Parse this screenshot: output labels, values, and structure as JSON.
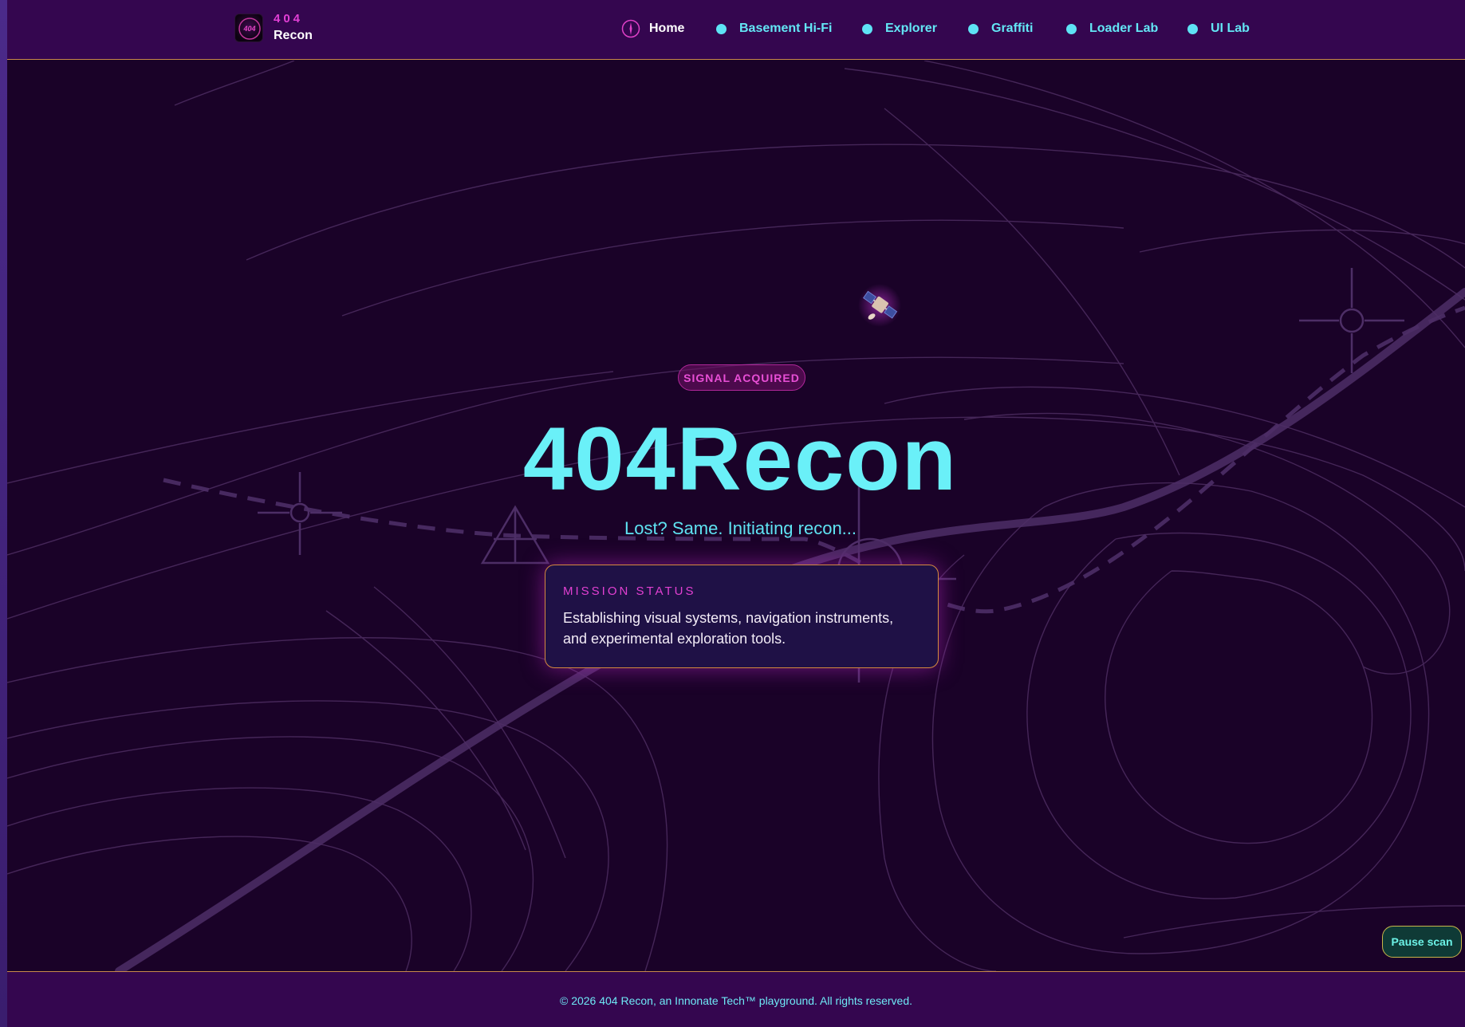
{
  "brand": {
    "logo_text": "404",
    "top": "404",
    "bottom": "Recon"
  },
  "nav": {
    "items": [
      {
        "label": "Home",
        "icon": "compass-icon",
        "active": true
      },
      {
        "label": "Basement Hi-Fi",
        "icon": "dot-icon"
      },
      {
        "label": "Explorer",
        "icon": "dot-icon"
      },
      {
        "label": "Graffiti",
        "icon": "dot-icon"
      },
      {
        "label": "Loader Lab",
        "icon": "dot-icon"
      },
      {
        "label": "UI Lab",
        "icon": "dot-icon"
      }
    ]
  },
  "hero": {
    "badge": "SIGNAL ACQUIRED",
    "title": "404Recon",
    "subtitle": "Lost? Same. Initiating recon..."
  },
  "mission": {
    "label": "MISSION STATUS",
    "text": "Establishing visual systems, navigation instruments, and experimental exploration tools."
  },
  "controls": {
    "pause": "Pause scan"
  },
  "footer": {
    "text": "© 2026 404 Recon, an Innonate Tech™ playground. All rights reserved."
  },
  "colors": {
    "background": "#1a0228",
    "bar": "#34064f",
    "accent_cyan": "#6af0f8",
    "accent_magenta": "#e240d2",
    "border_amber": "#d48a3e"
  }
}
